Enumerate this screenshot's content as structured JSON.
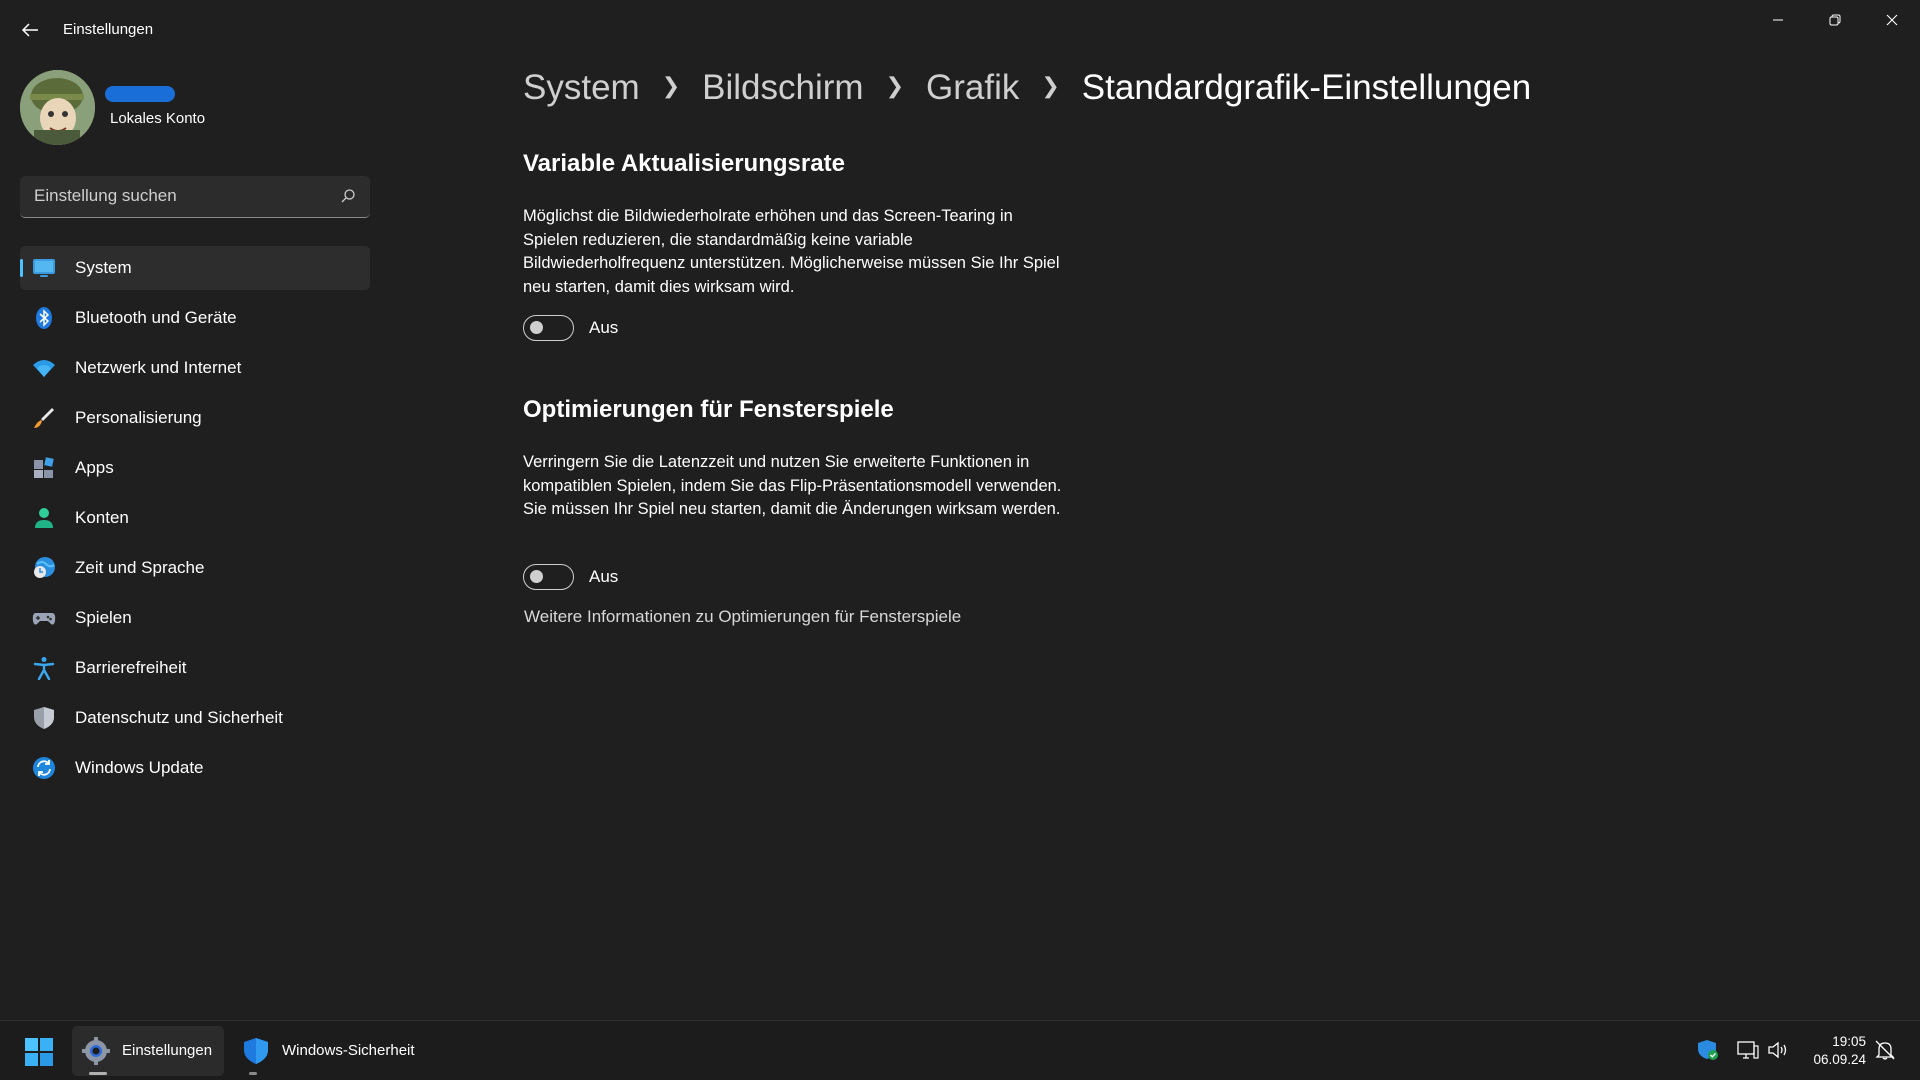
{
  "window": {
    "title": "Einstellungen"
  },
  "profile": {
    "account_type": "Lokales Konto"
  },
  "search": {
    "placeholder": "Einstellung suchen"
  },
  "sidebar": {
    "items": [
      {
        "label": "System",
        "icon": "monitor-icon",
        "active": true
      },
      {
        "label": "Bluetooth und Geräte",
        "icon": "bluetooth-icon"
      },
      {
        "label": "Netzwerk und Internet",
        "icon": "wifi-icon"
      },
      {
        "label": "Personalisierung",
        "icon": "brush-icon"
      },
      {
        "label": "Apps",
        "icon": "apps-icon"
      },
      {
        "label": "Konten",
        "icon": "person-icon"
      },
      {
        "label": "Zeit und Sprache",
        "icon": "globe-clock-icon"
      },
      {
        "label": "Spielen",
        "icon": "gamepad-icon"
      },
      {
        "label": "Barrierefreiheit",
        "icon": "accessibility-icon"
      },
      {
        "label": "Datenschutz und Sicherheit",
        "icon": "shield-icon"
      },
      {
        "label": "Windows Update",
        "icon": "update-icon"
      }
    ]
  },
  "breadcrumb": [
    "System",
    "Bildschirm",
    "Grafik",
    "Standardgrafik-Einstellungen"
  ],
  "sections": {
    "vrr": {
      "title": "Variable Aktualisierungsrate",
      "description": "Möglichst die Bildwiederholrate erhöhen und das Screen-Tearing in Spielen reduzieren, die standardmäßig keine variable Bildwiederholfrequenz unterstützen. Möglicherweise müssen Sie Ihr Spiel neu starten, damit dies wirksam wird.",
      "toggle_state": "Aus"
    },
    "windowed": {
      "title": "Optimierungen für Fensterspiele",
      "description": "Verringern Sie die Latenzzeit und nutzen Sie erweiterte Funktionen in kompatiblen Spielen, indem Sie das Flip-Präsentationsmodell verwenden. Sie müssen Ihr Spiel neu starten, damit die Änderungen wirksam werden.",
      "toggle_state": "Aus",
      "link": "Weitere Informationen zu Optimierungen für Fensterspiele"
    }
  },
  "taskbar": {
    "apps": [
      {
        "label": "Einstellungen",
        "icon": "settings-gear-icon",
        "active": true
      },
      {
        "label": "Windows-Sicherheit",
        "icon": "windows-security-icon",
        "active": false
      }
    ],
    "clock": {
      "time": "19:05",
      "date": "06.09.24"
    }
  },
  "colors": {
    "accent": "#4cc2ff",
    "background": "#1f1f1f",
    "sidebar_active": "#2d2d2d"
  }
}
